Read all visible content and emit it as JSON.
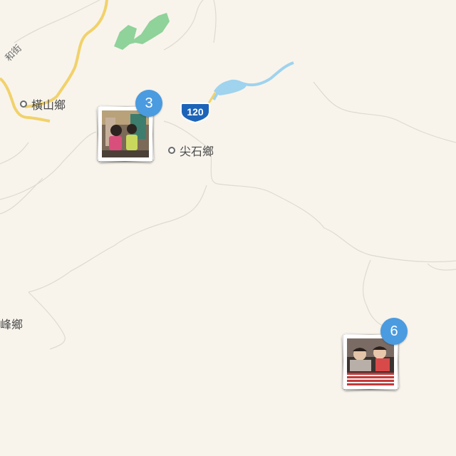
{
  "map": {
    "places": [
      {
        "id": "hengshan",
        "label": "橫山鄉"
      },
      {
        "id": "jianshi",
        "label": "尖石鄉"
      }
    ],
    "partial_labels": [
      {
        "id": "wufeng",
        "label": "峰鄉"
      },
      {
        "id": "road",
        "label": "和街"
      }
    ],
    "highway_shield": {
      "number": "120",
      "color": "#1d64b8"
    },
    "water_color": "#9fd3ee",
    "park_color": "#8fd29a",
    "road_color": "#f1d26b"
  },
  "clusters": [
    {
      "id": "cluster-a",
      "count": "3",
      "photo_desc": "two children with backpacks"
    },
    {
      "id": "cluster-b",
      "count": "6",
      "photo_desc": "two children sleeping"
    }
  ]
}
